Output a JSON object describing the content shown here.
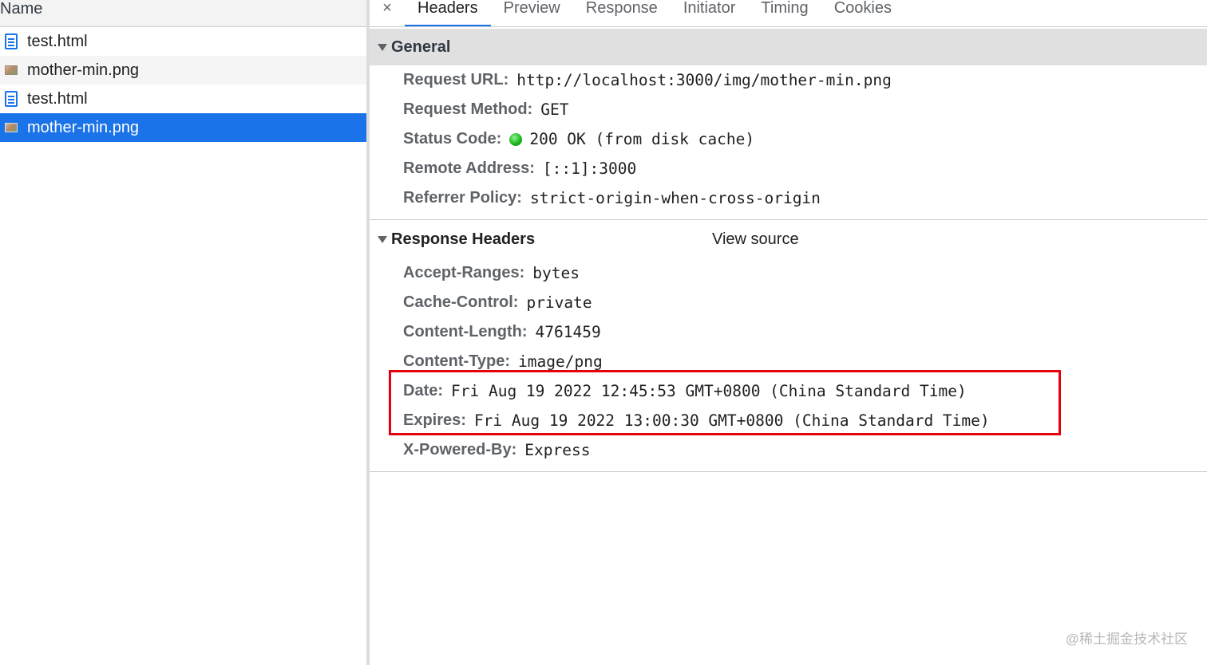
{
  "request_list": {
    "column_header": "Name",
    "items": [
      {
        "name": "test.html",
        "icon": "document-icon"
      },
      {
        "name": "mother-min.png",
        "icon": "image-icon"
      },
      {
        "name": "test.html",
        "icon": "document-icon"
      },
      {
        "name": "mother-min.png",
        "icon": "image-icon",
        "selected": true
      }
    ]
  },
  "tabs": {
    "close": "×",
    "items": [
      "Headers",
      "Preview",
      "Response",
      "Initiator",
      "Timing",
      "Cookies"
    ],
    "active": "Headers"
  },
  "general": {
    "title": "General",
    "rows": [
      {
        "key": "Request URL:",
        "value": "http://localhost:3000/img/mother-min.png"
      },
      {
        "key": "Request Method:",
        "value": "GET"
      },
      {
        "key": "Status Code:",
        "value": "200 OK (from disk cache)"
      },
      {
        "key": "Remote Address:",
        "value": "[::1]:3000"
      },
      {
        "key": "Referrer Policy:",
        "value": "strict-origin-when-cross-origin"
      }
    ]
  },
  "response_headers": {
    "title": "Response Headers",
    "view_source": "View source",
    "rows": [
      {
        "key": "Accept-Ranges:",
        "value": "bytes"
      },
      {
        "key": "Cache-Control:",
        "value": "private"
      },
      {
        "key": "Content-Length:",
        "value": "4761459"
      },
      {
        "key": "Content-Type:",
        "value": "image/png"
      },
      {
        "key": "Date:",
        "value": "Fri Aug 19 2022 12:45:53 GMT+0800 (China Standard Time)"
      },
      {
        "key": "Expires:",
        "value": "Fri Aug 19 2022 13:00:30 GMT+0800 (China Standard Time)"
      },
      {
        "key": "X-Powered-By:",
        "value": "Express"
      }
    ]
  },
  "colors": {
    "accent": "#1a73e8",
    "highlight_box": "#e5000b",
    "status_ok": "#1db61d"
  },
  "watermark": "@稀土掘金技术社区"
}
